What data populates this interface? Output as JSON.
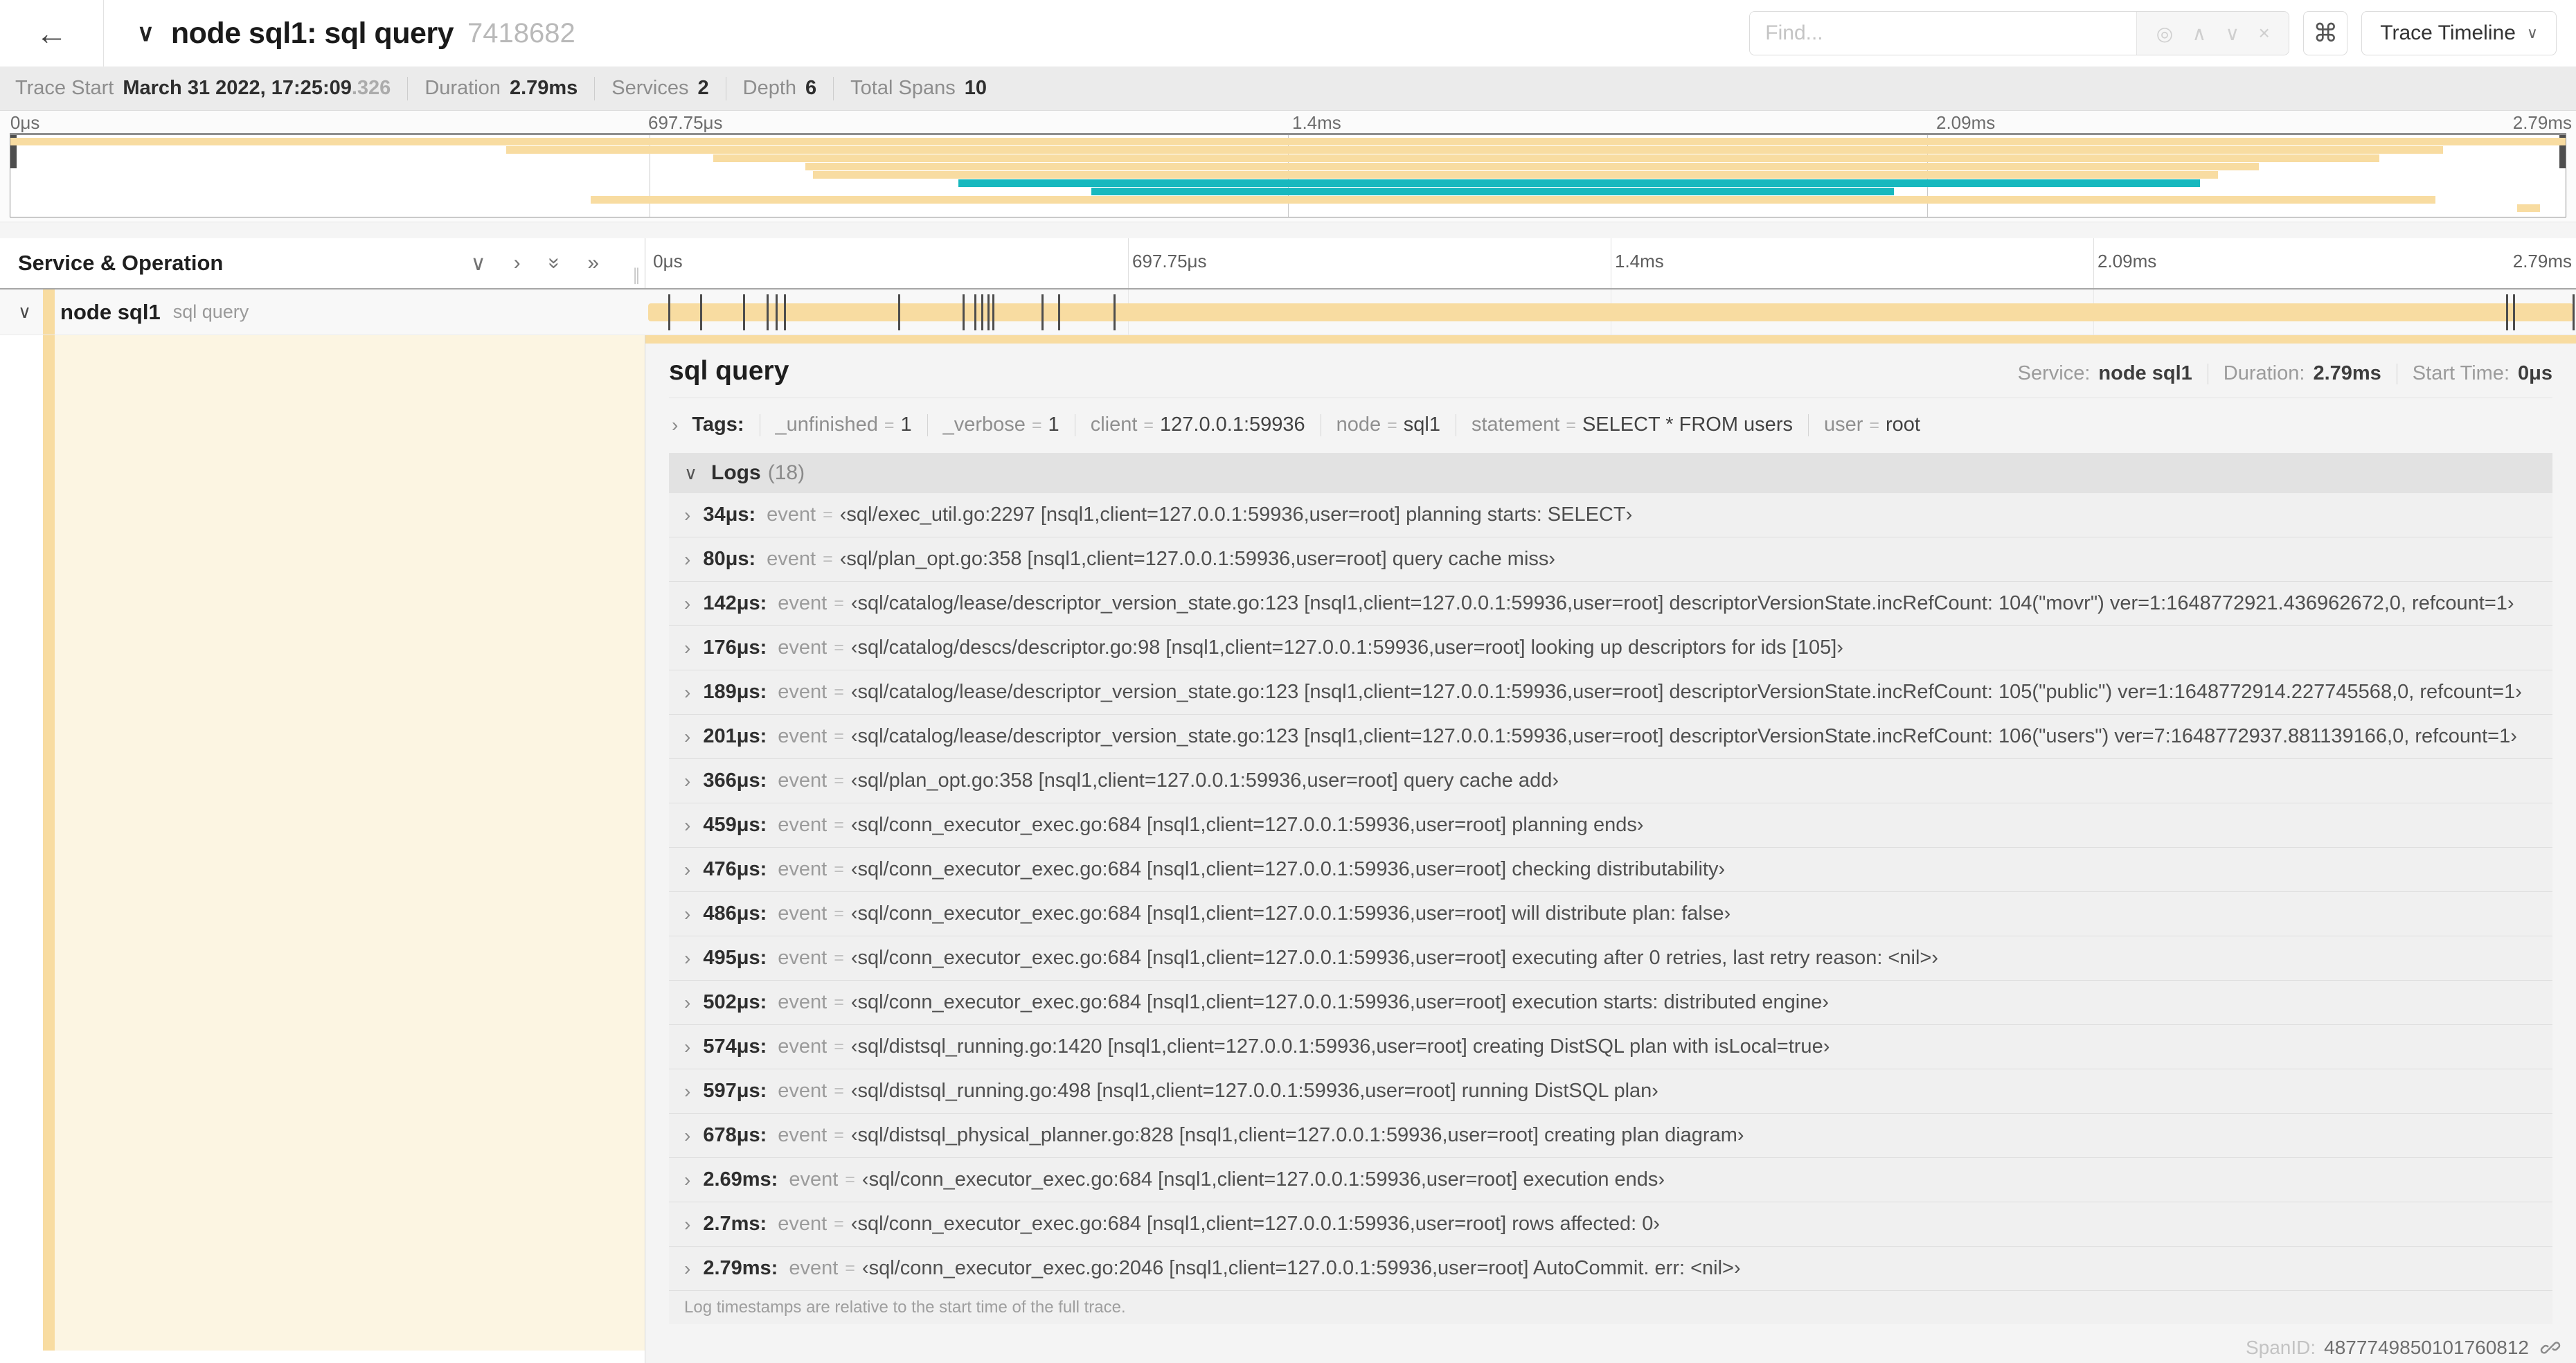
{
  "colors": {
    "span_tan": "#F8DCA1",
    "span_teal": "#17B8BE"
  },
  "header": {
    "back_icon": "←",
    "collapse_icon": "∨",
    "title": "node sql1: sql query",
    "trace_id": "7418682",
    "find_placeholder": "Find...",
    "locate_icon": "◎",
    "prev_icon": "∧",
    "next_icon": "∨",
    "clear_icon": "×",
    "shortcut_icon": "⌘",
    "view_label": "Trace Timeline",
    "view_caret": "∨"
  },
  "stats": [
    {
      "label": "Trace Start",
      "value": "March 31 2022, 17:25:09",
      "suffix": ".326"
    },
    {
      "label": "Duration",
      "value": "2.79ms",
      "suffix": ""
    },
    {
      "label": "Services",
      "value": "2",
      "suffix": ""
    },
    {
      "label": "Depth",
      "value": "6",
      "suffix": ""
    },
    {
      "label": "Total Spans",
      "value": "10",
      "suffix": ""
    }
  ],
  "ruler_ticks": [
    "0μs",
    "697.75μs",
    "1.4ms",
    "2.09ms",
    "2.79ms"
  ],
  "minimap": {
    "bars": [
      {
        "row": 0,
        "color": "span_tan",
        "start": 0.0,
        "end": 1.0
      },
      {
        "row": 1,
        "color": "span_tan",
        "start": 0.194,
        "end": 0.952
      },
      {
        "row": 2,
        "color": "span_tan",
        "start": 0.275,
        "end": 0.927
      },
      {
        "row": 3,
        "color": "span_tan",
        "start": 0.311,
        "end": 0.88
      },
      {
        "row": 4,
        "color": "span_tan",
        "start": 0.314,
        "end": 0.864
      },
      {
        "row": 5,
        "color": "span_teal",
        "start": 0.371,
        "end": 0.857
      },
      {
        "row": 6,
        "color": "span_teal",
        "start": 0.423,
        "end": 0.737
      },
      {
        "row": 7,
        "color": "span_tan",
        "start": 0.227,
        "end": 0.949
      },
      {
        "row": 8,
        "color": "span_tan",
        "start": 0.981,
        "end": 0.99
      }
    ]
  },
  "timeline": {
    "left_header": "Service & Operation",
    "collapse_one_icon": "∨",
    "expand_one_icon": "›",
    "collapse_all_icon": "»",
    "expand_all_icon": "»",
    "grip_icon": "∥",
    "row_chevron": "∨",
    "span_service": "node sql1",
    "span_operation": "sql query",
    "log_tick_fractions": [
      0.0122,
      0.0287,
      0.0509,
      0.0631,
      0.0677,
      0.072,
      0.1312,
      0.1645,
      0.1706,
      0.1742,
      0.1774,
      0.1799,
      0.2057,
      0.214,
      0.243,
      0.9642,
      0.9677,
      0.9985
    ]
  },
  "detail": {
    "title": "sql query",
    "overview": [
      {
        "label": "Service:",
        "value": "node sql1"
      },
      {
        "label": "Duration:",
        "value": "2.79ms"
      },
      {
        "label": "Start Time:",
        "value": "0μs"
      }
    ],
    "tags_chevron": "›",
    "tags_label": "Tags:",
    "tags": [
      {
        "key": "_unfinished",
        "value": "1"
      },
      {
        "key": "_verbose",
        "value": "1"
      },
      {
        "key": "client",
        "value": "127.0.0.1:59936"
      },
      {
        "key": "node",
        "value": "sql1"
      },
      {
        "key": "statement",
        "value": "SELECT * FROM users"
      },
      {
        "key": "user",
        "value": "root"
      }
    ],
    "logs_chevron": "∨",
    "logs_label": "Logs",
    "logs_count": "(18)",
    "row_chevron": "›",
    "field_name": "event",
    "eq": "=",
    "logs": [
      {
        "t": "34μs:",
        "value": "‹sql/exec_util.go:2297 [nsql1,client=127.0.0.1:59936,user=root] planning starts: SELECT›"
      },
      {
        "t": "80μs:",
        "value": "‹sql/plan_opt.go:358 [nsql1,client=127.0.0.1:59936,user=root] query cache miss›"
      },
      {
        "t": "142μs:",
        "value": "‹sql/catalog/lease/descriptor_version_state.go:123 [nsql1,client=127.0.0.1:59936,user=root] descriptorVersionState.incRefCount: 104(\"movr\") ver=1:1648772921.436962672,0, refcount=1›"
      },
      {
        "t": "176μs:",
        "value": "‹sql/catalog/descs/descriptor.go:98 [nsql1,client=127.0.0.1:59936,user=root] looking up descriptors for ids [105]›"
      },
      {
        "t": "189μs:",
        "value": "‹sql/catalog/lease/descriptor_version_state.go:123 [nsql1,client=127.0.0.1:59936,user=root] descriptorVersionState.incRefCount: 105(\"public\") ver=1:1648772914.227745568,0, refcount=1›"
      },
      {
        "t": "201μs:",
        "value": "‹sql/catalog/lease/descriptor_version_state.go:123 [nsql1,client=127.0.0.1:59936,user=root] descriptorVersionState.incRefCount: 106(\"users\") ver=7:1648772937.881139166,0, refcount=1›"
      },
      {
        "t": "366μs:",
        "value": "‹sql/plan_opt.go:358 [nsql1,client=127.0.0.1:59936,user=root] query cache add›"
      },
      {
        "t": "459μs:",
        "value": "‹sql/conn_executor_exec.go:684 [nsql1,client=127.0.0.1:59936,user=root] planning ends›"
      },
      {
        "t": "476μs:",
        "value": "‹sql/conn_executor_exec.go:684 [nsql1,client=127.0.0.1:59936,user=root] checking distributability›"
      },
      {
        "t": "486μs:",
        "value": "‹sql/conn_executor_exec.go:684 [nsql1,client=127.0.0.1:59936,user=root] will distribute plan: false›"
      },
      {
        "t": "495μs:",
        "value": "‹sql/conn_executor_exec.go:684 [nsql1,client=127.0.0.1:59936,user=root] executing after 0 retries, last retry reason: <nil>›"
      },
      {
        "t": "502μs:",
        "value": "‹sql/conn_executor_exec.go:684 [nsql1,client=127.0.0.1:59936,user=root] execution starts: distributed engine›"
      },
      {
        "t": "574μs:",
        "value": "‹sql/distsql_running.go:1420 [nsql1,client=127.0.0.1:59936,user=root] creating DistSQL plan with isLocal=true›"
      },
      {
        "t": "597μs:",
        "value": "‹sql/distsql_running.go:498 [nsql1,client=127.0.0.1:59936,user=root] running DistSQL plan›"
      },
      {
        "t": "678μs:",
        "value": "‹sql/distsql_physical_planner.go:828 [nsql1,client=127.0.0.1:59936,user=root] creating plan diagram›"
      },
      {
        "t": "2.69ms:",
        "value": "‹sql/conn_executor_exec.go:684 [nsql1,client=127.0.0.1:59936,user=root] execution ends›"
      },
      {
        "t": "2.7ms:",
        "value": "‹sql/conn_executor_exec.go:684 [nsql1,client=127.0.0.1:59936,user=root] rows affected: 0›"
      },
      {
        "t": "2.79ms:",
        "value": "‹sql/conn_executor_exec.go:2046 [nsql1,client=127.0.0.1:59936,user=root] AutoCommit. err: <nil>›"
      }
    ],
    "logs_footer": "Log timestamps are relative to the start time of the full trace.",
    "spanid_label": "SpanID:",
    "spanid_value": "4877749850101760812"
  }
}
